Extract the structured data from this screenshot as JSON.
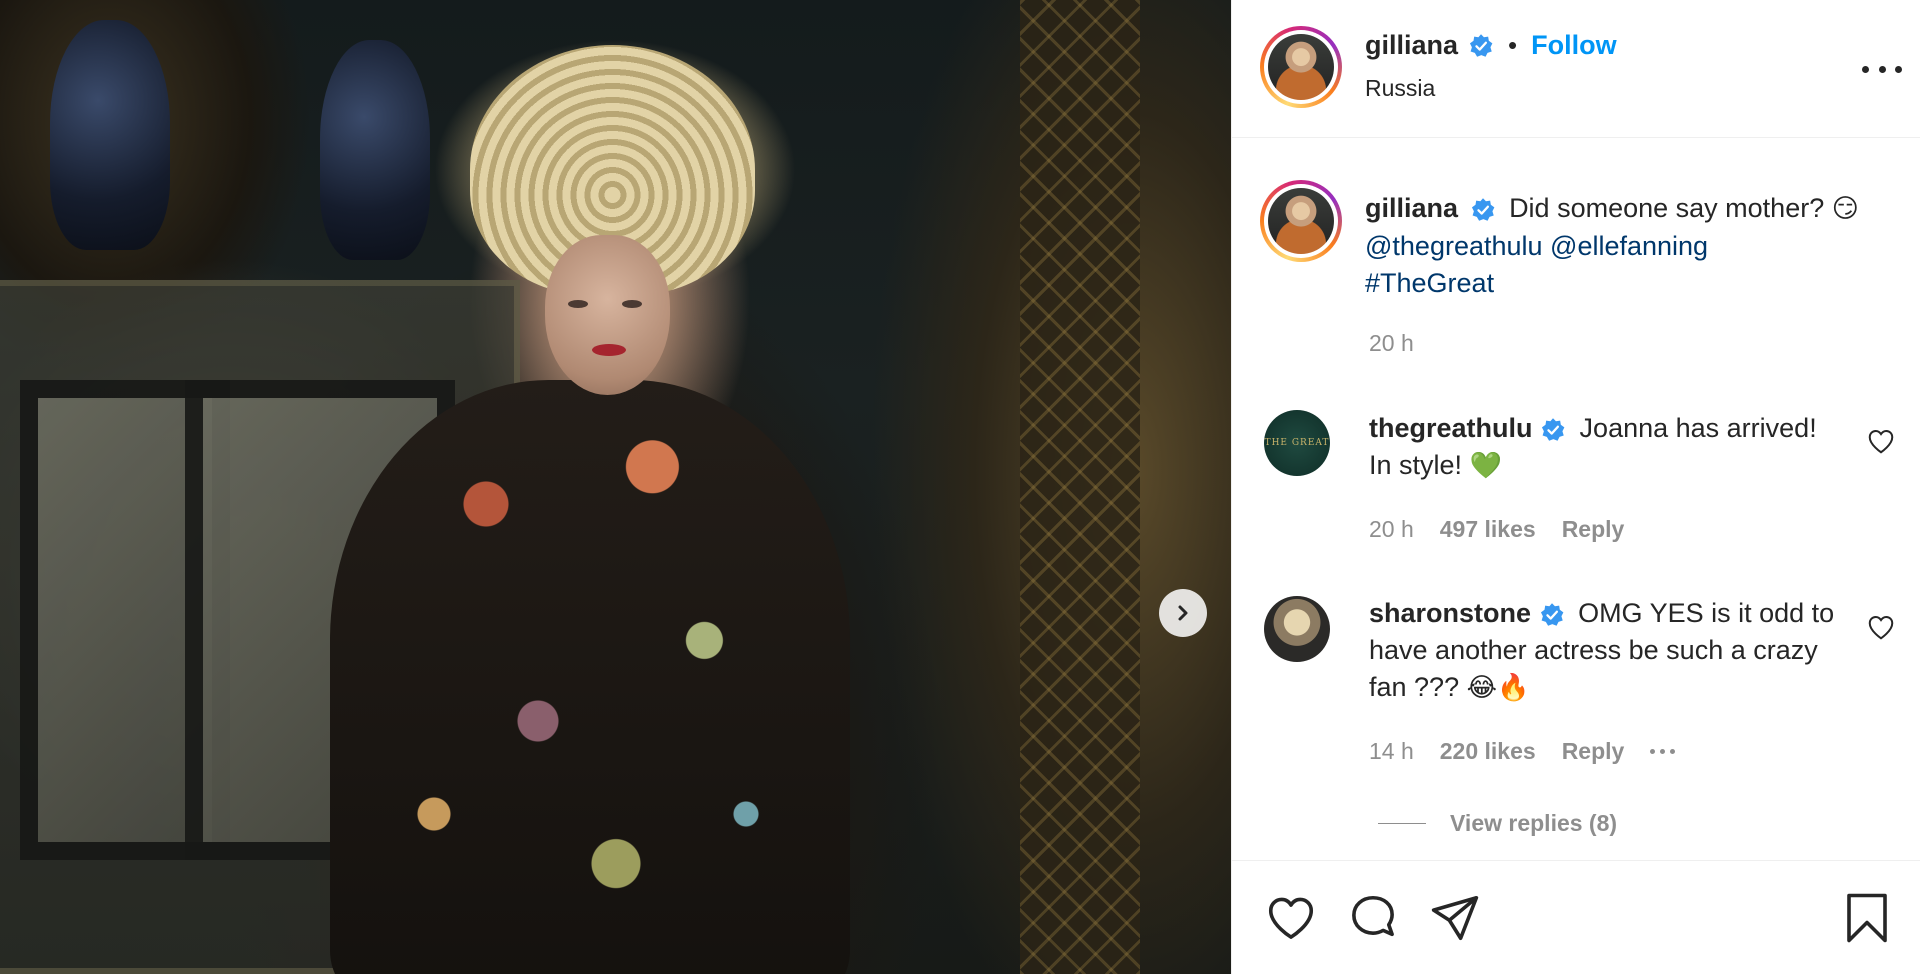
{
  "post": {
    "username": "gilliana",
    "separator": "•",
    "follow_label": "Follow",
    "location": "Russia",
    "more_icon": "more-horizontal-icon"
  },
  "caption": {
    "username": "gilliana",
    "text": "Did someone say mother?",
    "emoji": "😏",
    "mention_1": "@thegreathulu",
    "mention_2": "@ellefanning",
    "hashtag": "#TheGreat",
    "time": "20 h"
  },
  "comments": [
    {
      "username": "thegreathulu",
      "text": "Joanna has arrived! In style!",
      "emoji": "💚",
      "time": "20 h",
      "likes": "497 likes",
      "reply_label": "Reply",
      "avatar_text": "THE GREAT"
    },
    {
      "username": "sharonstone",
      "text": "OMG YES is it odd to have another actress be such a crazy fan ???",
      "emoji": "😂🔥",
      "time": "14 h",
      "likes": "220 likes",
      "reply_label": "Reply"
    }
  ],
  "view_replies": "View replies (8)",
  "colors": {
    "accent_blue": "#0095f6",
    "link": "#00376b",
    "muted": "#8e8e8e",
    "text": "#262626"
  }
}
